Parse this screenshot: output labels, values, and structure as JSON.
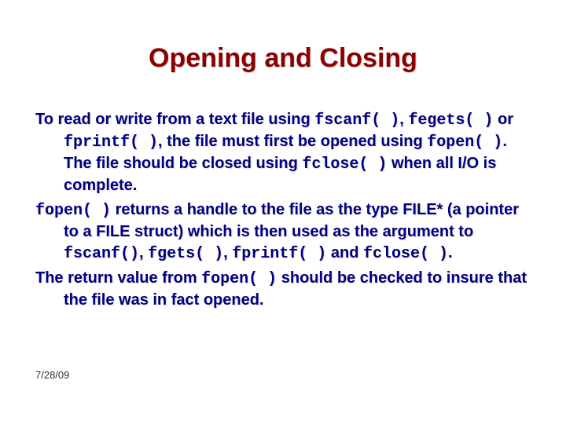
{
  "slide": {
    "title": "Opening and Closing",
    "p1": {
      "t1": "To read or write from a text file using ",
      "c1": "fscanf( )",
      "t2": ", ",
      "c2": "fegets( )",
      "t3": " or ",
      "c3": "fprintf( )",
      "t4": ", the file must first be opened using ",
      "c4": "fopen( )",
      "t5": ". The file should be closed using ",
      "c5": "fclose( )",
      "t6": " when all I/O is complete."
    },
    "p2": {
      "c1": "fopen( )",
      "t1": " returns a handle to the file as the type FILE* (a pointer to a FILE struct) which is then used as the argument to ",
      "c2": "fscanf()",
      "t2": ", ",
      "c3": "fgets( )",
      "t3": ", ",
      "c4": "fprintf( )",
      "t4": " and ",
      "c5": "fclose( )",
      "t5": "."
    },
    "p3": {
      "t1": "The return value from ",
      "c1": "fopen( )",
      "t2": " should be checked to insure that the file was in fact opened."
    },
    "footer_date": "7/28/09"
  }
}
